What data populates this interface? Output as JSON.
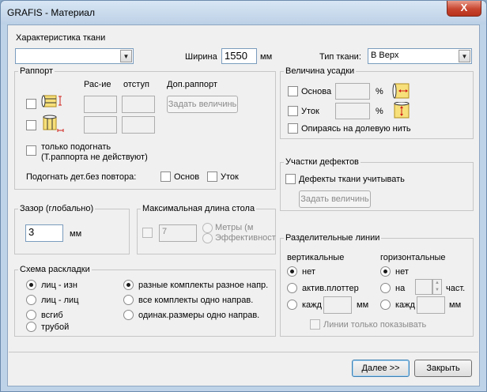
{
  "window": {
    "title": "GRAFIS - Материал",
    "close_label": "X"
  },
  "top": {
    "fabric_char_label": "Характеристика ткани",
    "fabric_char_value": "",
    "width_label": "Ширина",
    "width_value": "1550",
    "width_unit": "мм",
    "fabric_type_label": "Тип ткани:",
    "fabric_type_value": "В Верх"
  },
  "rapport": {
    "legend": "Раппорт",
    "col_rasie": "Рас-ие",
    "col_otstup": "отступ",
    "col_dop": "Доп.раппорт",
    "set_value_button": "Задать величинь",
    "fit_only_label": "только подогнать",
    "fit_only_note": "(Т.раппорта не действуют)",
    "fit_no_repeat_label": "Подогнать дет.без повтора:",
    "osnov_label": "Основ",
    "utok_label": "Уток"
  },
  "shrinkage": {
    "legend": "Величина усадки",
    "osnova_label": "Основа",
    "utok_label": "Уток",
    "percent": "%",
    "grain_label": "Опираясь на долевую нить"
  },
  "defects": {
    "legend": "Участки дефектов",
    "consider_label": "Дефекты ткани учитывать",
    "set_value_button": "Задать величинь"
  },
  "gap": {
    "legend": "Зазор (глобально)",
    "value": "3",
    "unit": "мм"
  },
  "table_length": {
    "legend": "Максимальная длина стола",
    "value": "7",
    "meters_label": "Метры (м",
    "efficiency_label": "Эффективност"
  },
  "layout_scheme": {
    "legend": "Схема раскладки",
    "left_options": [
      "лиц - изн",
      "лиц - лиц",
      "всгиб",
      "трубой"
    ],
    "right_options": [
      "разные комплекты разное напр.",
      "все комплекты одно направ.",
      "одинак.размеры одно направ."
    ]
  },
  "dividers": {
    "legend": "Разделительные линии",
    "vertical_label": "вертикальные",
    "horizontal_label": "горизонтальные",
    "v_none": "нет",
    "v_active_plotter": "актив.плоттер",
    "v_each": "кажд",
    "h_none": "нет",
    "h_on": "на",
    "h_parts": "част.",
    "h_each": "кажд",
    "unit": "мм",
    "show_only_label": "Линии только показывать"
  },
  "buttons": {
    "next": "Далее >>",
    "close": "Закрыть"
  },
  "colors": {
    "window_frame": "#bfd3e8",
    "dialog_bg": "#f0f0f0",
    "icon_yellow": "#f7e07a",
    "icon_red_mark": "#d0201a"
  }
}
